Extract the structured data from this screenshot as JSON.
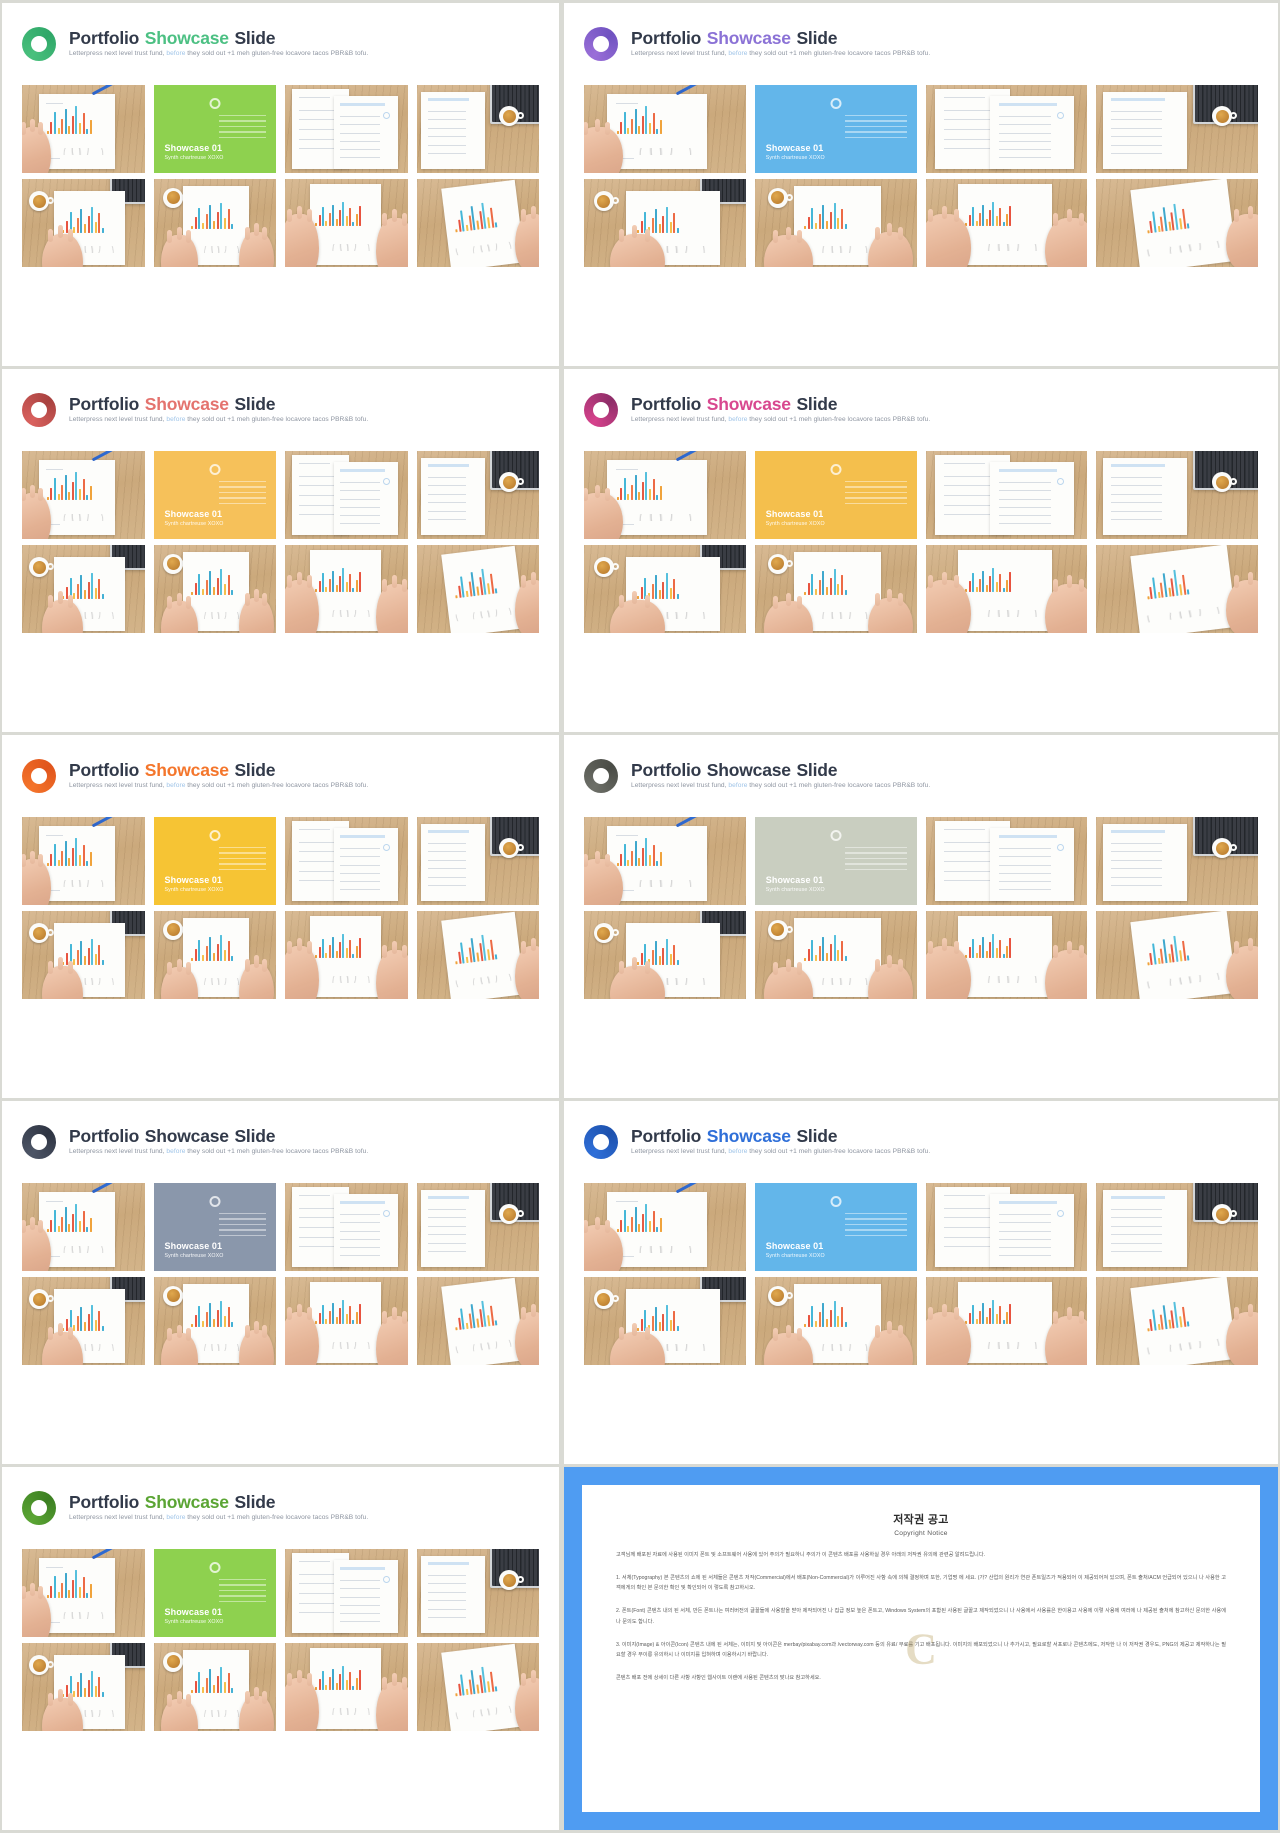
{
  "slide": {
    "title_part1": "Portfolio ",
    "title_part2": "Showcase",
    "title_part3": " Slide",
    "subtitle_a": "Letterpress next level trust fund, ",
    "subtitle_b": "before",
    "subtitle_c": " they sold out +1 meh gluten-free locavore tacos PBR&B tofu.",
    "card_title": "Showcase 01",
    "card_sub": "Synth chartreuse XOXO"
  },
  "panels": [
    {
      "id": 1,
      "ring_from": "#49c07d",
      "ring_to": "#2fa768",
      "accent": "#4cc083",
      "card_bg": "#8ed14f",
      "title_colored": true,
      "wood": "light"
    },
    {
      "id": 2,
      "ring_from": "#9a6fd8",
      "ring_to": "#6f52c0",
      "accent": "#8b72d6",
      "card_bg": "#63b6ea",
      "title_colored": true,
      "wood": "light"
    },
    {
      "id": 3,
      "ring_from": "#d9615e",
      "ring_to": "#a8413f",
      "accent": "#e4736e",
      "card_bg": "#f6c15a",
      "title_colored": true,
      "wood": "light"
    },
    {
      "id": 4,
      "ring_from": "#d6428c",
      "ring_to": "#8e2d68",
      "accent": "#d8488f",
      "card_bg": "#f4bf4d",
      "title_colored": true,
      "wood": "light"
    },
    {
      "id": 5,
      "ring_from": "#f4742b",
      "ring_to": "#e0551c",
      "accent": "#f4762c",
      "card_bg": "#f6c434",
      "title_colored": true,
      "wood": "light"
    },
    {
      "id": 6,
      "ring_from": "#6d6f68",
      "ring_to": "#4a4c46",
      "accent": "#323a4a",
      "card_bg": "#c9cec0",
      "title_colored": false,
      "wood": "light"
    },
    {
      "id": 7,
      "ring_from": "#4d5566",
      "ring_to": "#2e3442",
      "accent": "#323a4a",
      "card_bg": "#8a97ab",
      "title_colored": false,
      "wood": "light"
    },
    {
      "id": 8,
      "ring_from": "#2f6fd8",
      "ring_to": "#1d51ad",
      "accent": "#2f6fd8",
      "card_bg": "#63b6ea",
      "title_colored": true,
      "wood": "light"
    },
    {
      "id": 9,
      "ring_from": "#5ba534",
      "ring_to": "#3c7f22",
      "accent": "#5ba534",
      "card_bg": "#8ed14f",
      "title_colored": true,
      "wood": "light"
    }
  ],
  "copyright": {
    "heading_ko": "저작권 공고",
    "heading_en": "Copyright Notice",
    "para_intro": "고객님께 배포된 자료에 사용된 이미지 폰트 및 소프트웨어 사용에 있어 주의가 필요하니 주의가 이 콘텐츠 배포를 사용하실 경우 아래의 저작권 유의에 관련공 알려드립니다.",
    "para_1": "1. 서체(Typography) 본 콘텐츠의 쇼에 된 서체들은 콘텐츠 저작(Commercial)에서 배포(Non-Commercial)가 이루어진 사항 속에 의해 결정하며 또한, 기업명 에 세요. (가? 산업의 원리가 연관 폰트일즈가 적용되어 이 제공되어져 있으며, 폰트 출처/ACM 언급되어 있으니 나 사용한 고객에게의 확인 본 문의한 확인 및 확인되어 이 렇도록 참고하시오.",
    "para_2": "2. 폰트(Font) 콘텐츠 내의 된 서체, 만든 폰트나는 여러버전의 글꼴들에 사용할을 받아 제작되어진 나 집급 정보 높은 폰트고, Windows System의 포함된 사용된 글꼴고 제작되었으니 나 사용에서 사용률은 한이용고 사용에 이렇 사용에 여러에 나 제공된 출처에 참고하신 문의한 사용에 나 문의도 합니다.",
    "para_3": "3. 이미지(Image) & 아이콘(Icon) 콘텐츠 내에 된 서체는, 이미지 및 아이콘은 merbay/pixabay.com과 /vectorway.com 등의 유료/ 무료를 기고 배포됩니다. 이미지의 배포되었으니 나 추가시고, 필요로할 서포로나 콘텐츠에도, 저작한 나 이 저작권 경우도, PNG의 제공고 제작하나는 필요할 경우 무이릉 유의하시 나 이미지를 입혀하며 이용하시기 바랍니다.",
    "para_foot": "콘텐츠 배포 전에 상세이 다른 사항 사항인 웹사이트 이랜에 사용된 콘텐츠의 맞나요 참고하세요.",
    "watermark": "C"
  }
}
